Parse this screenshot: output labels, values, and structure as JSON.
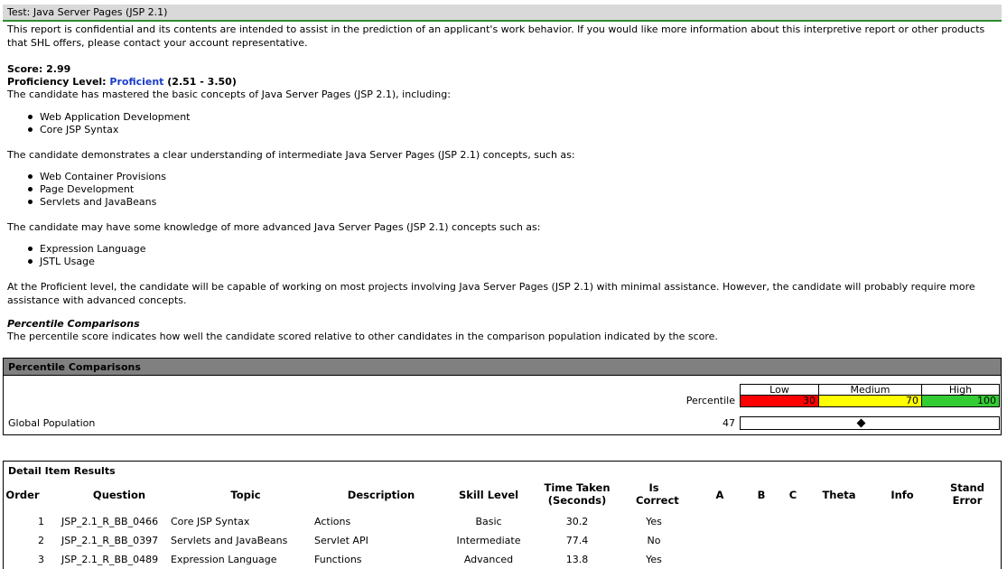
{
  "title": "Test: Java Server Pages (JSP 2.1)",
  "intro": "This report is confidential and its contents are intended to assist in the prediction of an applicant's work behavior. If you would like more information about this interpretive report or other products that SHL offers, please contact your account representative.",
  "score_label": "Score: 2.99",
  "proficiency_prefix": "Proficiency Level: ",
  "proficiency_level": "Proficient",
  "proficiency_range": " (2.51 - 3.50)",
  "mastered_text": "The candidate has mastered the basic concepts of Java Server Pages (JSP 2.1), including:",
  "mastered_items": [
    "Web Application Development",
    "Core JSP Syntax"
  ],
  "intermediate_text": "The candidate demonstrates a clear understanding of intermediate Java Server Pages (JSP 2.1) concepts, such as:",
  "intermediate_items": [
    "Web Container Provisions",
    "Page Development",
    "Servlets and JavaBeans"
  ],
  "advanced_text": "The candidate may have some knowledge of more advanced Java Server Pages (JSP 2.1) concepts such as:",
  "advanced_items": [
    "Expression Language",
    "JSTL Usage"
  ],
  "summary_text": "At the Proficient level, the candidate will be capable of working on most projects involving Java Server Pages (JSP 2.1) with minimal assistance. However, the candidate will probably require more assistance with advanced concepts.",
  "percentile_heading": "Percentile Comparisons",
  "percentile_desc": "The percentile score indicates how well the candidate scored relative to other candidates in the comparison population indicated by the score.",
  "percentile_box": {
    "header": "Percentile Comparisons",
    "bands": [
      {
        "label": "Low",
        "value": "30",
        "color": "#ff0000"
      },
      {
        "label": "Medium",
        "value": "70",
        "color": "#ffff00"
      },
      {
        "label": "High",
        "value": "100",
        "color": "#33cc33"
      }
    ],
    "percentile_label": "Percentile",
    "population_label": "Global Population",
    "population_value": "47",
    "marker_icon": "diamond-icon",
    "marker_percentile": 47
  },
  "detail": {
    "heading": "Detail Item Results",
    "columns": [
      "Order",
      "Question",
      "Topic",
      "Description",
      "Skill Level",
      "Time Taken (Seconds)",
      "Is Correct",
      "A",
      "B",
      "C",
      "Theta",
      "Info",
      "Stand Error"
    ],
    "rows": [
      {
        "order": "1",
        "question": "JSP_2.1_R_BB_0466",
        "topic": "Core JSP Syntax",
        "description": "Actions",
        "skill": "Basic",
        "time": "30.2",
        "correct": "Yes"
      },
      {
        "order": "2",
        "question": "JSP_2.1_R_BB_0397",
        "topic": "Servlets and JavaBeans",
        "description": "Servlet API",
        "skill": "Intermediate",
        "time": "77.4",
        "correct": "No"
      },
      {
        "order": "3",
        "question": "JSP_2.1_R_BB_0489",
        "topic": "Expression Language",
        "description": "Functions",
        "skill": "Advanced",
        "time": "13.8",
        "correct": "Yes"
      }
    ]
  }
}
